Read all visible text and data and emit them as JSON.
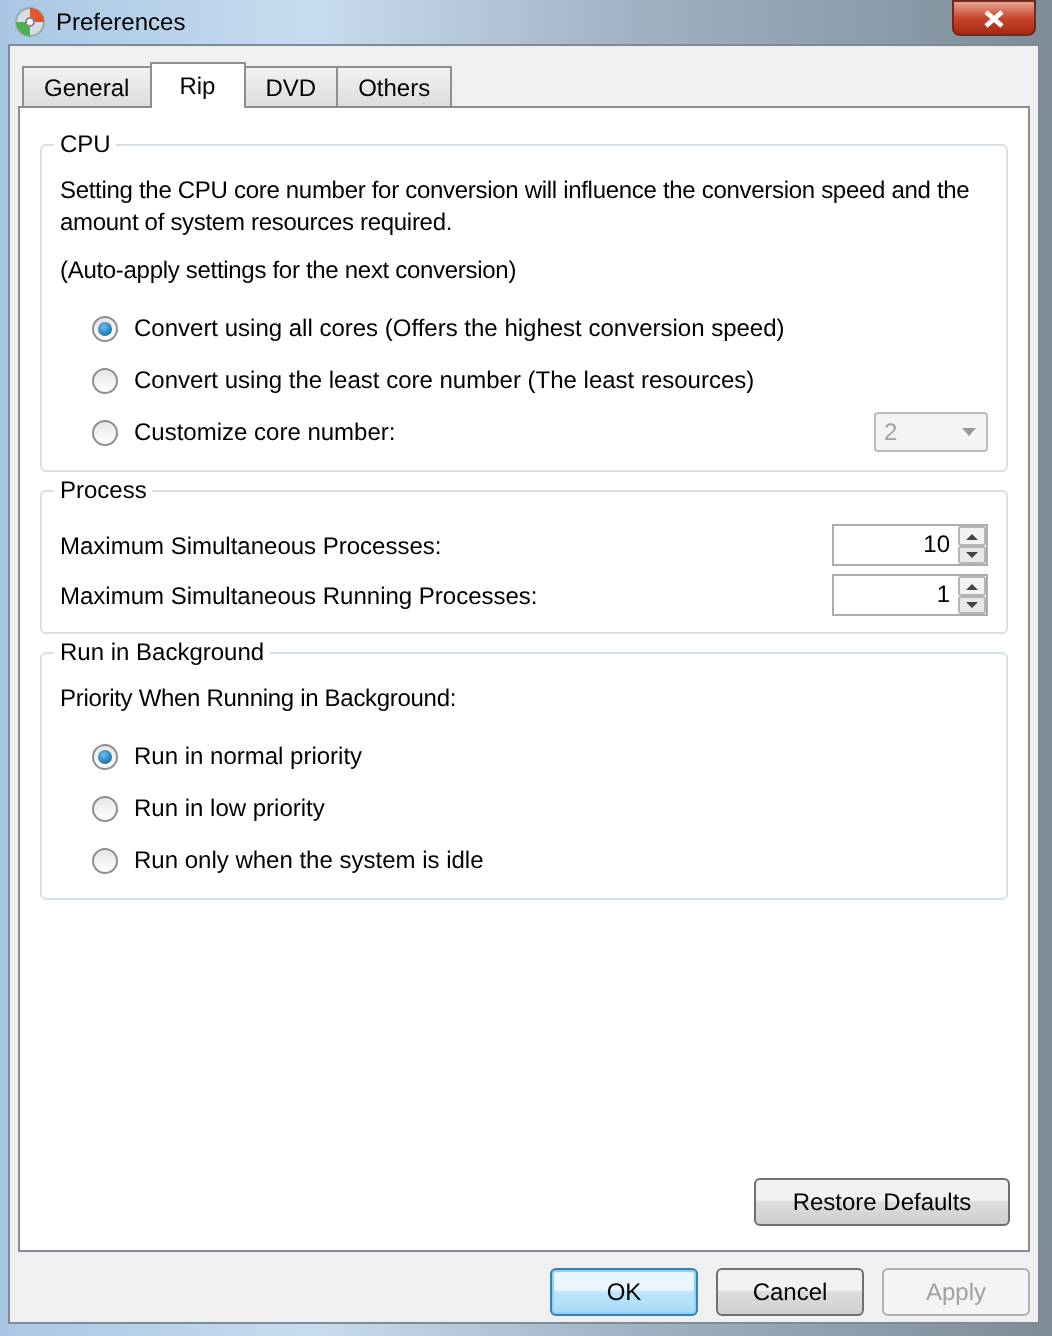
{
  "window": {
    "title": "Preferences"
  },
  "tabs": [
    {
      "label": "General",
      "selected": false
    },
    {
      "label": "Rip",
      "selected": true
    },
    {
      "label": "DVD",
      "selected": false
    },
    {
      "label": "Others",
      "selected": false
    }
  ],
  "groups": [
    {
      "title": "CPU",
      "items": [
        {
          "kind": "text",
          "text": "Setting the CPU core number for conversion will influence the conversion speed and the amount of system resources required."
        },
        {
          "kind": "text",
          "text": "(Auto-apply settings for the next conversion)"
        },
        {
          "kind": "radio",
          "label": "Convert using all cores (Offers the highest conversion speed)",
          "selected": true
        },
        {
          "kind": "radio",
          "label": "Convert using the least core number (The least resources)",
          "selected": false
        },
        {
          "kind": "radio",
          "label": "Customize core number:",
          "selected": false,
          "dropdown": {
            "value": "2",
            "disabled": true
          }
        }
      ]
    },
    {
      "title": "Process",
      "items": [
        {
          "kind": "spin",
          "label": "Maximum Simultaneous Processes:",
          "value": "10"
        },
        {
          "kind": "spin",
          "label": "Maximum Simultaneous Running Processes:",
          "value": "1"
        }
      ]
    },
    {
      "title": "Run in Background",
      "items": [
        {
          "kind": "text",
          "text": "Priority When Running in Background:"
        },
        {
          "kind": "radio",
          "label": "Run in normal priority",
          "selected": true
        },
        {
          "kind": "radio",
          "label": "Run in low priority",
          "selected": false
        },
        {
          "kind": "radio",
          "label": "Run only when the system is idle",
          "selected": false
        }
      ]
    }
  ],
  "restore_button": {
    "label": "Restore Defaults"
  },
  "buttons": [
    {
      "label": "OK",
      "default": true,
      "disabled": false
    },
    {
      "label": "Cancel",
      "default": false,
      "disabled": false
    },
    {
      "label": "Apply",
      "default": false,
      "disabled": true
    }
  ]
}
